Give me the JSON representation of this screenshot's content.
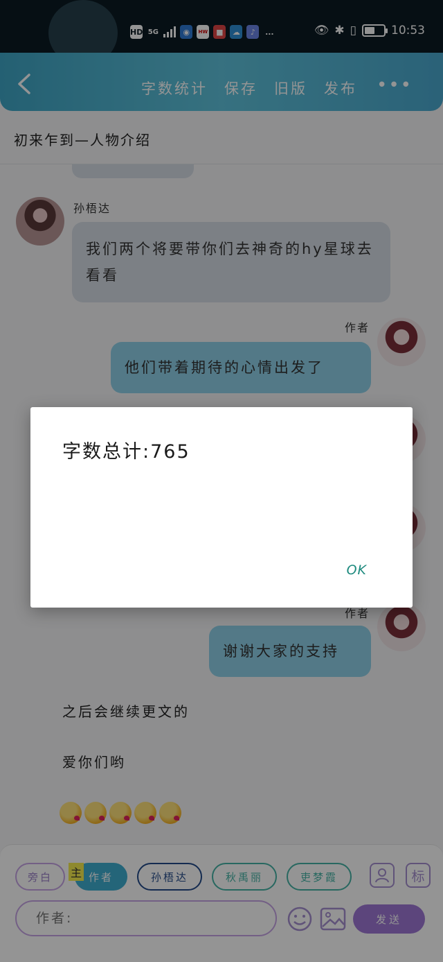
{
  "status_bar": {
    "icons": [
      "HD",
      "5G",
      "signal-bars",
      "location-icon",
      "huawei-icon",
      "red-app-icon",
      "cloud-app-icon",
      "music-app-icon",
      "..."
    ],
    "time": "10:53",
    "battery_level": 0.55
  },
  "header": {
    "actions": [
      "字数统计",
      "保存",
      "旧版",
      "发布"
    ],
    "more": "•••"
  },
  "document": {
    "title": "初来乍到—人物介绍"
  },
  "chat": {
    "message1": {
      "speaker": "孙梧达",
      "text": "我们两个将要带你们去神奇的hy星球去看看"
    },
    "message2": {
      "speaker": "作者",
      "text": "他们带着期待的心情出发了"
    },
    "message3": {
      "speaker": "作者",
      "text": "谢谢大家的支持"
    },
    "narration1": "之后会继续更文的",
    "narration2": "爱你们哟",
    "emoji_count": 5
  },
  "toolbar": {
    "chips": {
      "aside": "旁白",
      "main_tag": "主",
      "author": "作者",
      "sun": "孙梧达",
      "qiu": "秋禹丽",
      "geng": "吏梦霞"
    },
    "tag_button": "标",
    "input_placeholder": "作者:",
    "send": "发送"
  },
  "dialog": {
    "message": "字数总计:765",
    "ok": "OK"
  },
  "colors": {
    "header": "#4fb6d3",
    "accent_purple": "#9f78d6",
    "ok_teal": "#1d8a7e"
  }
}
